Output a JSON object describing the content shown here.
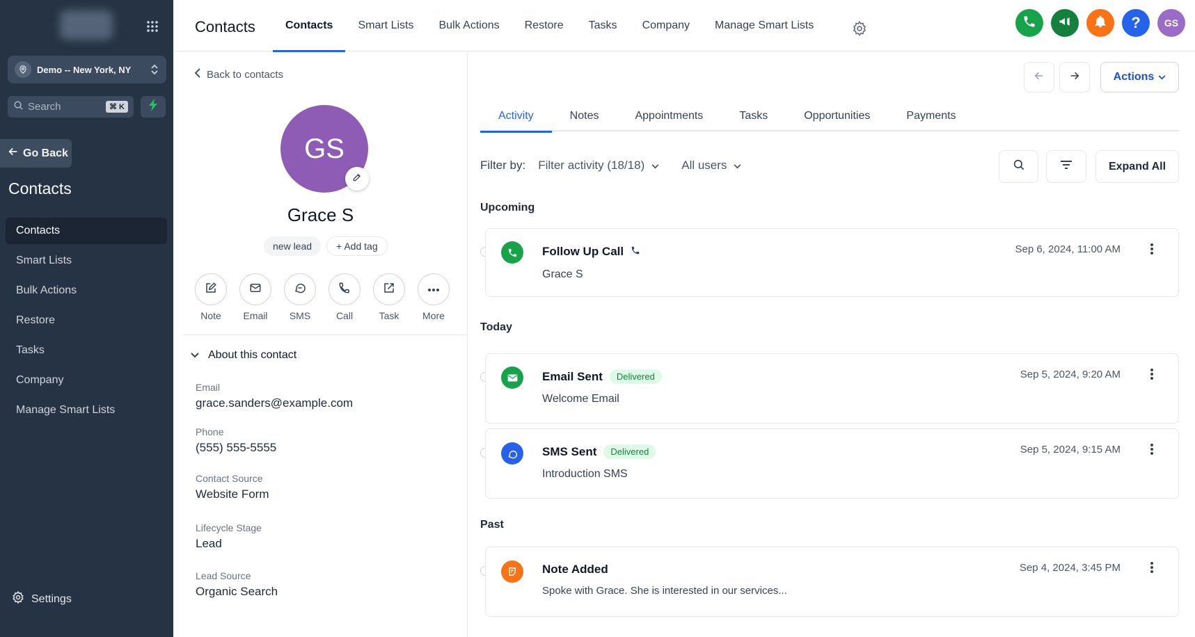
{
  "sidebar": {
    "location": "Demo -- New York, NY",
    "search_placeholder": "Search",
    "search_shortcut": "⌘ K",
    "go_back": "Go Back",
    "title": "Contacts",
    "items": [
      {
        "label": "Contacts"
      },
      {
        "label": "Smart Lists"
      },
      {
        "label": "Bulk Actions"
      },
      {
        "label": "Restore"
      },
      {
        "label": "Tasks"
      },
      {
        "label": "Company"
      },
      {
        "label": "Manage Smart Lists"
      }
    ],
    "settings": "Settings"
  },
  "topbar": {
    "title": "Contacts",
    "tabs": [
      {
        "label": "Contacts"
      },
      {
        "label": "Smart Lists"
      },
      {
        "label": "Bulk Actions"
      },
      {
        "label": "Restore"
      },
      {
        "label": "Tasks"
      },
      {
        "label": "Company"
      },
      {
        "label": "Manage Smart Lists"
      }
    ],
    "user_initials": "GS",
    "colors": {
      "phone": "#16a34a",
      "megaphone": "#15803d",
      "bell": "#f97316",
      "help": "#2563eb",
      "avatar": "#9b6cc5"
    }
  },
  "contact": {
    "back_label": "Back to contacts",
    "initials": "GS",
    "name": "Grace S",
    "tags": [
      "new lead"
    ],
    "add_tag": "+ Add tag",
    "actions": [
      {
        "label": "Note",
        "icon": "note-icon"
      },
      {
        "label": "Email",
        "icon": "email-icon"
      },
      {
        "label": "SMS",
        "icon": "sms-icon"
      },
      {
        "label": "Call",
        "icon": "call-icon"
      },
      {
        "label": "Task",
        "icon": "task-icon"
      },
      {
        "label": "More",
        "icon": "more-icon"
      }
    ],
    "about_title": "About this contact",
    "fields": [
      {
        "label": "Email",
        "value": "grace.sanders@example.com"
      },
      {
        "label": "Phone",
        "value": "(555) 555-5555"
      },
      {
        "label": "Contact Source",
        "value": "Website Form"
      },
      {
        "label": "Lifecycle Stage",
        "value": "Lead"
      },
      {
        "label": "Lead Source",
        "value": "Organic Search"
      }
    ]
  },
  "activity": {
    "actions_label": "Actions",
    "tabs": [
      {
        "label": "Activity"
      },
      {
        "label": "Notes"
      },
      {
        "label": "Appointments"
      },
      {
        "label": "Tasks"
      },
      {
        "label": "Opportunities"
      },
      {
        "label": "Payments"
      }
    ],
    "filter_label": "Filter by:",
    "filter_activity": "Filter activity (18/18)",
    "filter_users": "All users",
    "expand_all": "Expand All",
    "sections": {
      "upcoming": "Upcoming",
      "today": "Today",
      "past": "Past"
    },
    "items": [
      {
        "title": "Follow Up Call",
        "subtitle": "Grace S",
        "date": "Sep 6, 2024, 11:00 AM",
        "icon": "phone-icon",
        "color": "#16a34a"
      },
      {
        "title": "Email Sent",
        "badge": "Delivered",
        "subtitle": "Welcome Email",
        "date": "Sep 5, 2024, 9:20 AM",
        "icon": "mail-icon",
        "color": "#16a34a"
      },
      {
        "title": "SMS Sent",
        "badge": "Delivered",
        "subtitle": "Introduction SMS",
        "date": "Sep 5, 2024, 9:15 AM",
        "icon": "chat-icon",
        "color": "#2563eb"
      },
      {
        "title": "Note Added",
        "subtitle": "Spoke with Grace. She is interested in our services...",
        "date": "Sep 4, 2024, 3:45 PM",
        "icon": "note-icon",
        "color": "#f97316"
      }
    ]
  }
}
